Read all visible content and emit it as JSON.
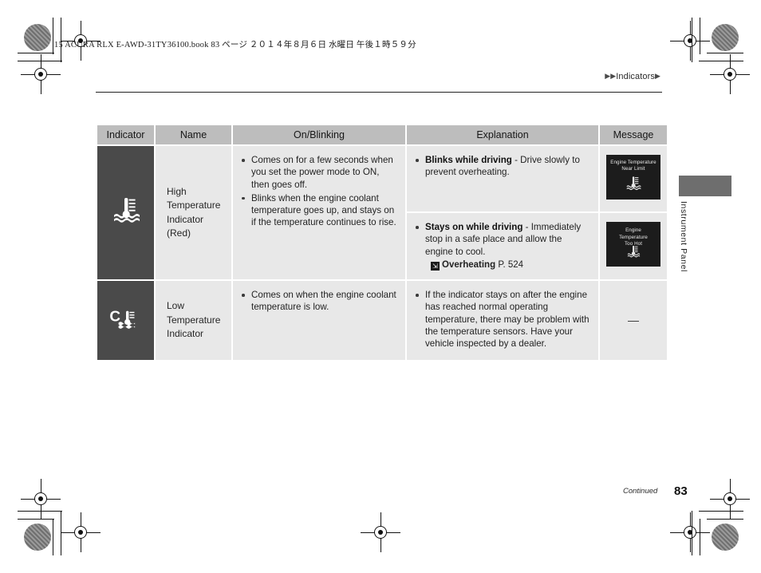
{
  "page": {
    "book_line": "15 ACURA RLX E-AWD-31TY36100.book   83 ページ   ２０１４年８月６日   水曜日   午後１時５９分",
    "breadcrumb_text": "Indicators",
    "side_tab_label": "Instrument Panel",
    "continued_label": "Continued",
    "page_number": "83"
  },
  "table": {
    "headers": [
      "Indicator",
      "Name",
      "On/Blinking",
      "Explanation",
      "Message"
    ],
    "rows": [
      {
        "indicator_icon": "high-temperature-thermometer-icon",
        "name": "High\nTemperature\nIndicator\n(Red)",
        "name_lines": [
          "High",
          "Temperature",
          "Indicator",
          "(Red)"
        ],
        "on_blinking": [
          "Comes on for a few seconds when you set the power mode to ON, then goes off.",
          "Blinks when the engine coolant temperature goes up, and stays on if the temperature continues to rise."
        ],
        "explanations": [
          {
            "lead": "Blinks while driving",
            "text": " - Drive slowly to prevent overheating.",
            "xref": null,
            "message": {
              "lines": [
                "Engine Temperature",
                "Near Limit"
              ],
              "icon": "thermometer-coolant-icon"
            }
          },
          {
            "lead": "Stays on while driving",
            "text": " - Immediately stop in a safe place and allow the engine to cool.",
            "xref": {
              "icon": "jump-to-arrow-icon",
              "title": "Overheating",
              "page": "P. 524"
            },
            "message": {
              "lines": [
                "Engine",
                "Temperature",
                "Too Hot"
              ],
              "icon": "thermometer-coolant-icon"
            }
          }
        ]
      },
      {
        "indicator_icon": "low-temperature-c-thermometer-icon",
        "name": "Low Temperature Indicator",
        "name_lines": [
          "Low Temperature",
          "Indicator"
        ],
        "on_blinking": [
          "Comes on when the engine coolant temperature is low."
        ],
        "explanations": [
          {
            "lead": null,
            "text": "If the indicator stays on after the engine has reached normal operating temperature, there may be problem with the temperature sensors. Have your vehicle inspected by a dealer.",
            "xref": null,
            "message": {
              "lines": [],
              "placeholder": "—"
            }
          }
        ]
      }
    ]
  },
  "colors": {
    "header_bg": "#bdbdbd",
    "cell_bg": "#e8e8e8",
    "icon_cell_bg": "#4a4a4a",
    "display_bg": "#1c1c1c",
    "tab_bg": "#6e6e6e"
  }
}
